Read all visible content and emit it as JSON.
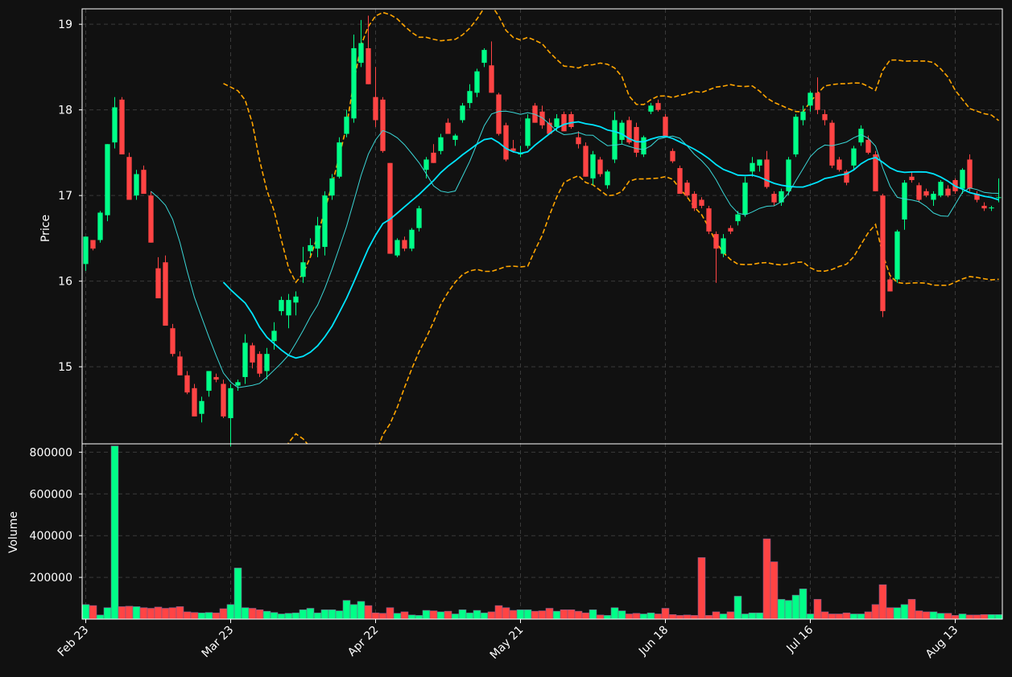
{
  "chart_data": {
    "type": "candlestick",
    "grid": true,
    "colors": {
      "background": "#111111",
      "up": "#00ff88",
      "down": "#ff4444",
      "ma_slow": "#00e5ff",
      "ma_fast": "#3ad6d6",
      "bollinger": "#ffa500",
      "grid": "#3a3a3a",
      "frame": "#ffffff"
    },
    "price_panel": {
      "ylabel": "Price",
      "ylim": [
        14.1,
        19.18
      ],
      "ticks": [
        "15",
        "16",
        "17",
        "18",
        "19"
      ],
      "tick_values": [
        15,
        16,
        17,
        18,
        19
      ]
    },
    "volume_panel": {
      "ylabel": "Volume",
      "ylim": [
        0,
        840000
      ],
      "ticks": [
        "200000",
        "400000",
        "600000",
        "800000"
      ],
      "tick_values": [
        200000,
        400000,
        600000,
        800000
      ]
    },
    "x_ticks": [
      {
        "label": "Feb 23",
        "index": 0
      },
      {
        "label": "Mar 23",
        "index": 20
      },
      {
        "label": "Apr 22",
        "index": 40
      },
      {
        "label": "May 21",
        "index": 60
      },
      {
        "label": "Jun 18",
        "index": 80
      },
      {
        "label": "Jul 16",
        "index": 100
      },
      {
        "label": "Aug 13",
        "index": 120
      }
    ],
    "candles": [
      [
        16.2,
        16.52,
        16.12,
        16.52,
        70000
      ],
      [
        16.48,
        16.48,
        16.36,
        16.38,
        65000
      ],
      [
        16.48,
        16.82,
        16.45,
        16.8,
        20000
      ],
      [
        16.77,
        17.6,
        16.7,
        17.6,
        55000
      ],
      [
        17.62,
        18.15,
        17.55,
        18.03,
        830000
      ],
      [
        18.12,
        18.15,
        17.48,
        17.48,
        60000
      ],
      [
        17.45,
        17.5,
        16.95,
        16.95,
        62000
      ],
      [
        17.0,
        17.3,
        16.95,
        17.25,
        60000
      ],
      [
        17.3,
        17.35,
        17.05,
        17.02,
        55000
      ],
      [
        17.0,
        17.05,
        16.45,
        16.45,
        52000
      ],
      [
        16.15,
        16.28,
        15.8,
        15.8,
        58000
      ],
      [
        16.22,
        16.3,
        15.48,
        15.48,
        52000
      ],
      [
        15.45,
        15.5,
        15.12,
        15.15,
        55000
      ],
      [
        15.12,
        15.18,
        14.9,
        14.9,
        60000
      ],
      [
        14.9,
        14.95,
        14.68,
        14.7,
        35000
      ],
      [
        14.75,
        14.8,
        14.42,
        14.42,
        32000
      ],
      [
        14.45,
        14.65,
        14.35,
        14.6,
        30000
      ],
      [
        14.72,
        14.95,
        14.65,
        14.95,
        32000
      ],
      [
        14.88,
        14.92,
        14.82,
        14.85,
        30000
      ],
      [
        14.8,
        14.85,
        14.4,
        14.42,
        50000
      ],
      [
        14.4,
        14.8,
        14.07,
        14.75,
        70000
      ],
      [
        14.78,
        14.85,
        14.72,
        14.82,
        245000
      ],
      [
        14.88,
        15.38,
        14.8,
        15.28,
        55000
      ],
      [
        15.25,
        15.28,
        14.98,
        15.05,
        52000
      ],
      [
        15.15,
        15.18,
        14.88,
        14.92,
        45000
      ],
      [
        14.95,
        15.22,
        14.85,
        15.15,
        38000
      ],
      [
        15.3,
        15.52,
        15.2,
        15.42,
        32000
      ],
      [
        15.65,
        15.82,
        15.6,
        15.78,
        25000
      ],
      [
        15.6,
        15.85,
        15.45,
        15.78,
        28000
      ],
      [
        15.75,
        15.88,
        15.6,
        15.82,
        30000
      ],
      [
        16.05,
        16.4,
        15.98,
        16.22,
        45000
      ],
      [
        16.35,
        16.5,
        16.3,
        16.42,
        52000
      ],
      [
        16.38,
        16.75,
        16.28,
        16.65,
        30000
      ],
      [
        16.4,
        17.05,
        16.3,
        17.0,
        45000
      ],
      [
        17.0,
        17.25,
        16.95,
        17.2,
        45000
      ],
      [
        17.22,
        17.68,
        17.2,
        17.62,
        40000
      ],
      [
        17.72,
        18.0,
        17.68,
        17.92,
        90000
      ],
      [
        17.9,
        18.88,
        17.85,
        18.72,
        70000
      ],
      [
        18.55,
        19.05,
        18.5,
        18.78,
        85000
      ],
      [
        18.72,
        19.1,
        18.3,
        18.3,
        65000
      ],
      [
        18.15,
        18.5,
        17.8,
        17.88,
        30000
      ],
      [
        18.12,
        18.15,
        17.5,
        17.52,
        28000
      ],
      [
        17.38,
        17.38,
        16.32,
        16.32,
        55000
      ],
      [
        16.3,
        16.5,
        16.28,
        16.48,
        28000
      ],
      [
        16.48,
        16.52,
        16.35,
        16.38,
        35000
      ],
      [
        16.38,
        16.62,
        16.35,
        16.6,
        20000
      ],
      [
        16.62,
        16.88,
        16.58,
        16.85,
        18000
      ],
      [
        17.3,
        17.45,
        17.2,
        17.42,
        42000
      ],
      [
        17.5,
        17.6,
        17.38,
        17.38,
        40000
      ],
      [
        17.52,
        17.72,
        17.48,
        17.68,
        35000
      ],
      [
        17.85,
        17.9,
        17.72,
        17.72,
        38000
      ],
      [
        17.65,
        17.72,
        17.58,
        17.7,
        25000
      ],
      [
        17.88,
        18.08,
        17.85,
        18.05,
        45000
      ],
      [
        18.08,
        18.3,
        18.02,
        18.22,
        30000
      ],
      [
        18.2,
        18.48,
        18.15,
        18.45,
        42000
      ],
      [
        18.55,
        18.72,
        18.5,
        18.7,
        30000
      ],
      [
        18.52,
        18.8,
        18.2,
        18.2,
        35000
      ],
      [
        18.18,
        18.2,
        17.7,
        17.72,
        65000
      ],
      [
        17.82,
        17.85,
        17.4,
        17.42,
        55000
      ],
      [
        17.55,
        17.65,
        17.5,
        17.52,
        42000
      ],
      [
        17.48,
        17.58,
        17.45,
        17.5,
        45000
      ],
      [
        17.58,
        17.95,
        17.55,
        17.9,
        45000
      ],
      [
        18.05,
        18.08,
        17.85,
        17.85,
        38000
      ],
      [
        17.98,
        18.05,
        17.78,
        17.82,
        40000
      ],
      [
        17.85,
        17.9,
        17.72,
        17.72,
        52000
      ],
      [
        17.8,
        17.95,
        17.75,
        17.9,
        38000
      ],
      [
        17.95,
        17.98,
        17.75,
        17.75,
        45000
      ],
      [
        17.95,
        17.98,
        17.78,
        17.8,
        45000
      ],
      [
        17.68,
        17.75,
        17.55,
        17.6,
        38000
      ],
      [
        17.58,
        17.62,
        17.22,
        17.22,
        30000
      ],
      [
        17.2,
        17.52,
        17.12,
        17.48,
        45000
      ],
      [
        17.42,
        17.45,
        17.22,
        17.25,
        20000
      ],
      [
        17.12,
        17.3,
        17.08,
        17.28,
        18000
      ],
      [
        17.42,
        17.98,
        17.38,
        17.88,
        55000
      ],
      [
        17.65,
        17.88,
        17.6,
        17.85,
        40000
      ],
      [
        17.88,
        17.92,
        17.6,
        17.62,
        25000
      ],
      [
        17.8,
        17.85,
        17.45,
        17.5,
        28000
      ],
      [
        17.48,
        17.7,
        17.45,
        17.68,
        25000
      ],
      [
        17.98,
        18.08,
        17.95,
        18.05,
        30000
      ],
      [
        18.08,
        18.12,
        17.98,
        18.0,
        25000
      ],
      [
        17.92,
        17.95,
        17.68,
        17.68,
        52000
      ],
      [
        17.52,
        17.55,
        17.38,
        17.4,
        22000
      ],
      [
        17.32,
        17.35,
        17.02,
        17.02,
        18000
      ],
      [
        17.15,
        17.18,
        16.98,
        17.0,
        20000
      ],
      [
        17.02,
        17.05,
        16.82,
        16.85,
        18000
      ],
      [
        16.95,
        16.98,
        16.85,
        16.88,
        295000
      ],
      [
        16.85,
        16.88,
        16.55,
        16.58,
        18000
      ],
      [
        16.55,
        16.58,
        15.98,
        16.38,
        35000
      ],
      [
        16.32,
        16.55,
        16.28,
        16.5,
        25000
      ],
      [
        16.62,
        16.65,
        16.55,
        16.58,
        35000
      ],
      [
        16.7,
        16.82,
        16.65,
        16.78,
        110000
      ],
      [
        16.78,
        17.22,
        16.75,
        17.15,
        25000
      ],
      [
        17.28,
        17.45,
        17.22,
        17.38,
        30000
      ],
      [
        17.35,
        17.42,
        17.28,
        17.42,
        30000
      ],
      [
        17.42,
        17.52,
        17.08,
        17.1,
        385000
      ],
      [
        17.02,
        17.05,
        16.88,
        16.92,
        275000
      ],
      [
        16.92,
        17.08,
        16.88,
        17.05,
        95000
      ],
      [
        17.05,
        17.45,
        17.0,
        17.42,
        90000
      ],
      [
        17.48,
        17.95,
        17.45,
        17.92,
        115000
      ],
      [
        17.88,
        18.05,
        17.82,
        17.98,
        145000
      ],
      [
        18.05,
        18.22,
        17.98,
        18.2,
        25000
      ],
      [
        18.2,
        18.38,
        17.95,
        18.0,
        95000
      ],
      [
        17.95,
        18.0,
        17.82,
        17.88,
        35000
      ],
      [
        17.85,
        17.88,
        17.32,
        17.35,
        25000
      ],
      [
        17.42,
        17.45,
        17.28,
        17.3,
        25000
      ],
      [
        17.28,
        17.3,
        17.12,
        17.15,
        30000
      ],
      [
        17.35,
        17.58,
        17.3,
        17.55,
        25000
      ],
      [
        17.62,
        17.82,
        17.58,
        17.78,
        25000
      ],
      [
        17.65,
        17.7,
        17.48,
        17.5,
        35000
      ],
      [
        17.48,
        17.52,
        17.05,
        17.05,
        70000
      ],
      [
        17.0,
        17.02,
        15.58,
        15.65,
        165000
      ],
      [
        16.02,
        16.05,
        15.88,
        15.88,
        55000
      ],
      [
        16.02,
        16.6,
        15.98,
        16.58,
        55000
      ],
      [
        16.72,
        17.18,
        16.6,
        17.15,
        70000
      ],
      [
        17.22,
        17.28,
        17.15,
        17.18,
        95000
      ],
      [
        17.12,
        17.15,
        16.92,
        16.95,
        40000
      ],
      [
        17.05,
        17.08,
        16.98,
        17.0,
        35000
      ],
      [
        16.95,
        17.05,
        16.88,
        17.02,
        35000
      ],
      [
        17.0,
        17.18,
        16.98,
        17.16,
        28000
      ],
      [
        17.08,
        17.12,
        16.98,
        17.0,
        28000
      ],
      [
        17.18,
        17.2,
        17.02,
        17.05,
        18000
      ],
      [
        17.08,
        17.32,
        17.02,
        17.3,
        25000
      ],
      [
        17.42,
        17.48,
        17.05,
        17.08,
        20000
      ],
      [
        17.02,
        17.05,
        16.92,
        16.95,
        20000
      ],
      [
        16.88,
        16.92,
        16.82,
        16.85,
        22000
      ],
      [
        16.85,
        16.88,
        16.82,
        16.86,
        22000
      ],
      [
        16.98,
        17.2,
        16.92,
        16.98,
        22000
      ]
    ]
  }
}
